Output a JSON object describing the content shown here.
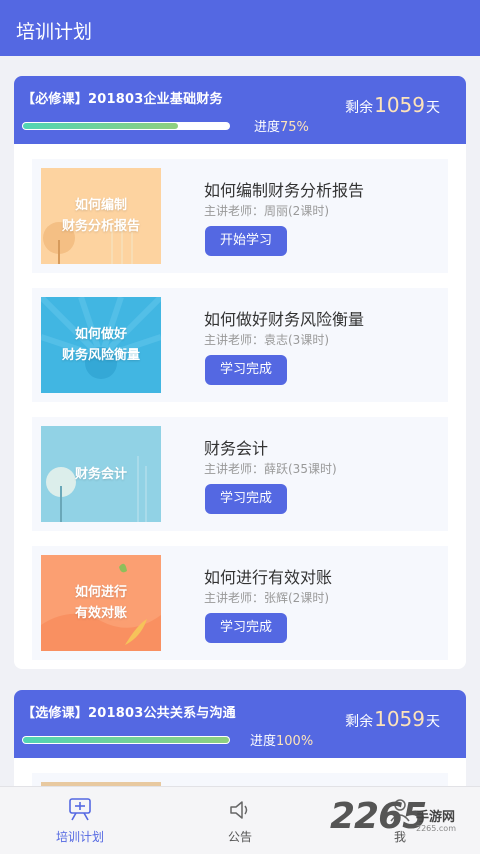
{
  "header": {
    "title": "培训计划"
  },
  "courses": [
    {
      "title": "【必修课】201803企业基础财务",
      "remain_prefix": "剩余",
      "remain_days": "1059",
      "remain_suffix": "天",
      "progress_label": "进度",
      "progress_percent": "75%",
      "progress_value": 0.75,
      "lessons": [
        {
          "thumb_line1": "如何编制",
          "thumb_line2": "财务分析报告",
          "title": "如何编制财务分析报告",
          "teacher": "主讲老师：周丽(2课时)",
          "button": "开始学习",
          "thumb_color": "#fcc98c"
        },
        {
          "thumb_line1": "如何做好",
          "thumb_line2": "财务风险衡量",
          "title": "如何做好财务风险衡量",
          "teacher": "主讲老师：袁志(3课时)",
          "button": "学习完成",
          "thumb_color": "#3fb3e0"
        },
        {
          "thumb_line1": "财务会计",
          "thumb_line2": "",
          "title": "财务会计",
          "teacher": "主讲老师：薛跃(35课时)",
          "button": "学习完成",
          "thumb_color": "#8fd0e4"
        },
        {
          "thumb_line1": "如何进行",
          "thumb_line2": "有效对账",
          "title": "如何进行有效对账",
          "teacher": "主讲老师：张辉(2课时)",
          "button": "学习完成",
          "thumb_color": "#fb9e70"
        }
      ]
    },
    {
      "title": "【选修课】201803公共关系与沟通",
      "remain_prefix": "剩余",
      "remain_days": "1059",
      "remain_suffix": "天",
      "progress_label": "进度",
      "progress_percent": "100%",
      "progress_value": 1.0
    }
  ],
  "tabbar": {
    "items": [
      {
        "label": "培训计划",
        "icon": "plan-icon",
        "active": true
      },
      {
        "label": "公告",
        "icon": "speaker-icon",
        "active": false
      },
      {
        "label": "我",
        "icon": "user-icon",
        "active": false
      }
    ]
  },
  "watermark": {
    "number": "2265",
    "text": "手游网",
    "url": "2265.com"
  },
  "colors": {
    "brand": "#5468e2",
    "accent": "#fde3b9",
    "progress": "#6fd1a4"
  }
}
